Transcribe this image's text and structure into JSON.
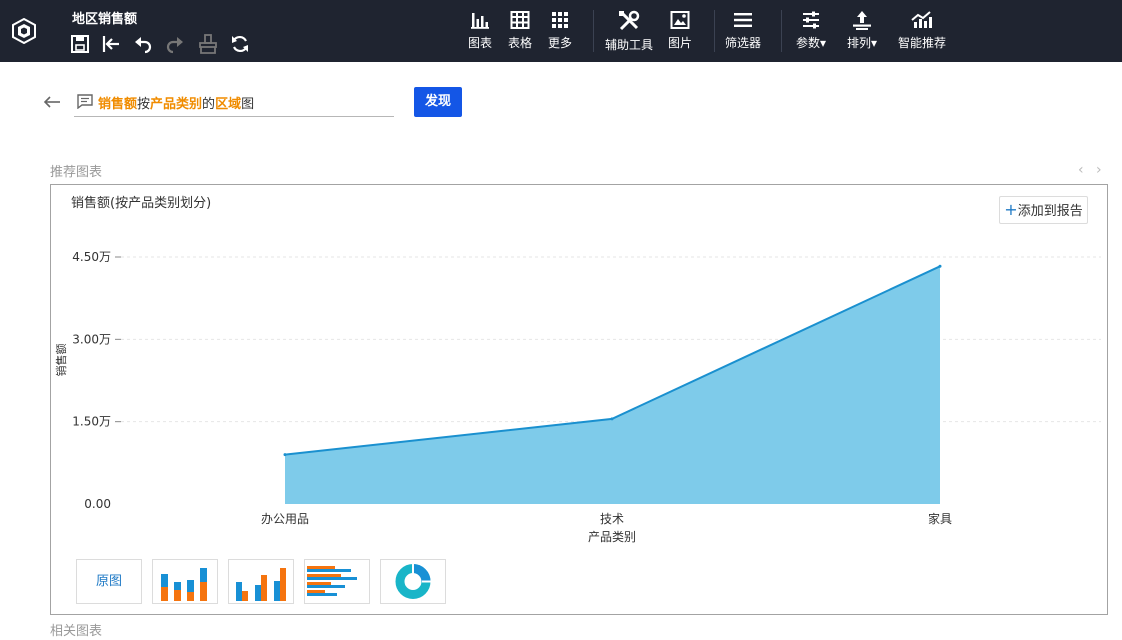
{
  "app": {
    "title": "地区销售额"
  },
  "quick_actions": [
    {
      "name": "save",
      "icon": "save-icon"
    },
    {
      "name": "exit-edit",
      "icon": "exit-icon"
    },
    {
      "name": "undo",
      "icon": "undo-icon"
    },
    {
      "name": "redo",
      "icon": "redo-icon"
    },
    {
      "name": "format-painter",
      "icon": "brush-icon"
    },
    {
      "name": "refresh",
      "icon": "refresh-icon"
    }
  ],
  "toolbar": {
    "chart": "图表",
    "table": "表格",
    "more": "更多",
    "assist": "辅助工具",
    "image": "图片",
    "filter": "筛选器",
    "params": "参数",
    "sort": "排列",
    "smart": "智能推荐"
  },
  "query": {
    "parts": [
      "销售额",
      "按",
      "产品类别",
      "的",
      "区域",
      "图"
    ],
    "highlight": [
      true,
      false,
      true,
      false,
      true,
      false
    ]
  },
  "discover_label": "发现",
  "recommended_label": "推荐图表",
  "related_label": "相关图表",
  "card": {
    "title": "销售额(按产品类别划分)",
    "add_label": "添加到报告",
    "thumbs": [
      "原图",
      "stacked-bar-icon",
      "grouped-bar-icon",
      "horizontal-bar-icon",
      "donut-icon"
    ]
  },
  "colors": {
    "area_fill": "#7ecbea",
    "area_line": "#1a90cf",
    "accent": "#1456e6",
    "orange": "#f5740f",
    "blue": "#1890d5",
    "teal": "#19b5c8"
  },
  "chart_data": {
    "type": "area",
    "categories": [
      "办公用品",
      "技术",
      "家具"
    ],
    "series": [
      {
        "values": [
          9000,
          15500,
          43300
        ]
      }
    ],
    "xlabel": "产品类别",
    "ylabel": "销售额",
    "ylim": [
      0,
      45000
    ],
    "yticks": [
      0,
      15000,
      30000,
      45000
    ],
    "ytick_labels": [
      "0.00",
      "1.50万",
      "3.00万",
      "4.50万"
    ],
    "grid": true
  }
}
